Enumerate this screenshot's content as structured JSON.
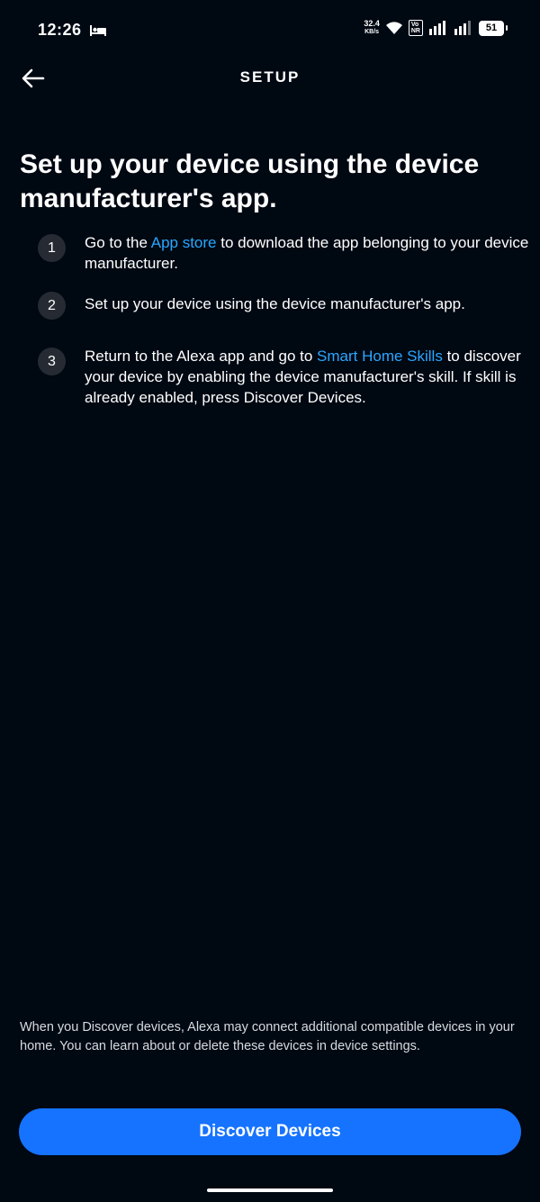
{
  "status_bar": {
    "time": "12:26",
    "net_speed": "32.4",
    "net_speed_unit": "KB/s",
    "volte_top": "Vo",
    "volte_bottom": "NR",
    "battery": "51"
  },
  "header": {
    "title": "SETUP"
  },
  "main": {
    "heading": "Set up your device using the device manufacturer's app.",
    "steps": [
      {
        "number": "1",
        "text_before": "Go to the ",
        "link": "App store",
        "text_after": " to download the app belonging to your device manufacturer."
      },
      {
        "number": "2",
        "text": "Set up your device using the device manufacturer's app."
      },
      {
        "number": "3",
        "text_before": "Return to the Alexa app and go to ",
        "link": "Smart Home Skills",
        "text_after": " to discover your device by enabling the device manufacturer's skill. If skill is already enabled, press Discover Devices."
      }
    ]
  },
  "footer": {
    "disclaimer": "When you Discover devices, Alexa may connect additional compatible devices in your home. You can learn about or delete these devices in device settings.",
    "button_label": "Discover Devices"
  },
  "colors": {
    "background": "#000812",
    "link": "#2aa7ff",
    "primary_button": "#1573ff",
    "step_circle": "#262b33"
  },
  "icons": {
    "back": "arrow-left-icon",
    "sleep": "bed-icon",
    "wifi": "wifi-icon",
    "signal": "signal-bars-icon",
    "battery": "battery-icon"
  }
}
